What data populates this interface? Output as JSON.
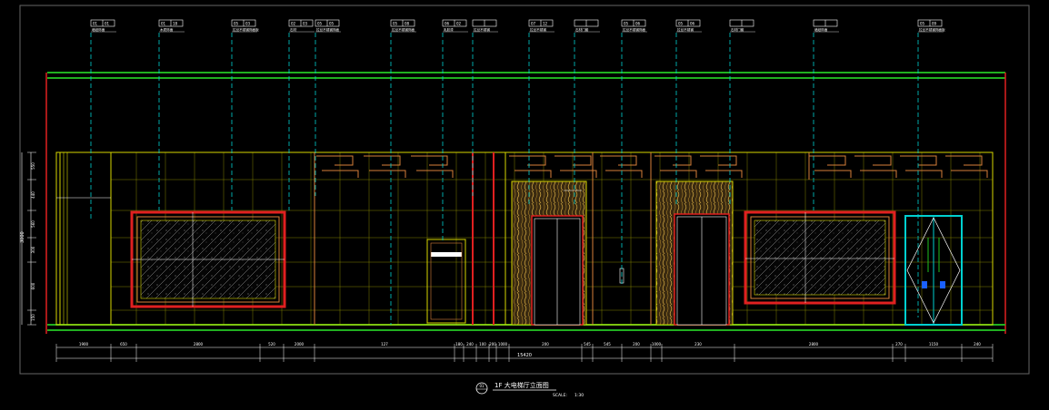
{
  "drawing": {
    "title": "1F 大电梯厅立面图",
    "scale_label": "SCALE:",
    "scale_value": "1:30",
    "sheet_no": "01",
    "overall_dim": "15420",
    "height_total": "3000"
  },
  "callouts": [
    {
      "code": "01",
      "sub": "01",
      "text": "墙纸饰面"
    },
    {
      "code": "01",
      "sub": "18",
      "text": "木质饰面"
    },
    {
      "code": "05",
      "sub": "03",
      "text": "拉丝不锈钢饰面板"
    },
    {
      "code": "02",
      "sub": "03",
      "text": "石材"
    },
    {
      "code": "05",
      "sub": "05",
      "text": "拉丝不锈钢饰面"
    },
    {
      "code": "05",
      "sub": "08",
      "text": "拉丝不锈钢饰面"
    },
    {
      "code": "06",
      "sub": "02",
      "text": "乳胶漆"
    },
    {
      "code": "",
      "sub": "",
      "text": "拉丝不锈钢"
    },
    {
      "code": "07",
      "sub": "12",
      "text": "拉丝不锈钢"
    },
    {
      "code": "",
      "sub": "",
      "text": "石材门套"
    },
    {
      "code": "05",
      "sub": "06",
      "text": "拉丝不锈钢饰面"
    },
    {
      "code": "05",
      "sub": "06",
      "text": "拉丝不锈钢"
    },
    {
      "code": "",
      "sub": "",
      "text": "石材门套"
    },
    {
      "code": "",
      "sub": "",
      "text": "墙纸饰面"
    },
    {
      "code": "05",
      "sub": "09",
      "text": "拉丝不锈钢饰面板"
    }
  ],
  "bottom_dims": [
    "1900",
    "650",
    "2800",
    "520",
    "2000",
    "127",
    "180",
    "240",
    "100",
    "200",
    "1000",
    "200",
    "545",
    "545",
    "200",
    "1000",
    "230",
    "2800",
    "270",
    "1150",
    "240"
  ],
  "left_dims": [
    "550",
    "440",
    "560",
    "300",
    "600",
    "150"
  ],
  "colors": {
    "background": "#000000",
    "outline": "#d6d600",
    "leader": "#00d0d0",
    "red": "#e02020",
    "green": "#20b020",
    "orange": "#d8803a",
    "white": "#ffffff",
    "door_fill": "#5a4a26"
  }
}
